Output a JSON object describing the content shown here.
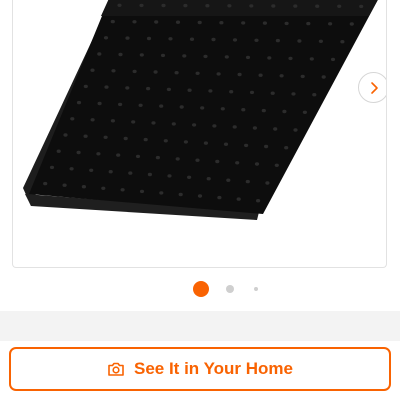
{
  "product_image": {
    "description_icon": "black-square-shower-head"
  },
  "carousel": {
    "next_icon": "chevron-right-icon",
    "active_index": 1,
    "dot_count": 3
  },
  "actions": {
    "see_it_label": "See It in Your Home",
    "see_it_icon": "camera-icon"
  },
  "colors": {
    "accent": "#f96302",
    "product": "#111111",
    "inactive_dot": "#cfcfcf",
    "band": "#f3f3f3"
  }
}
